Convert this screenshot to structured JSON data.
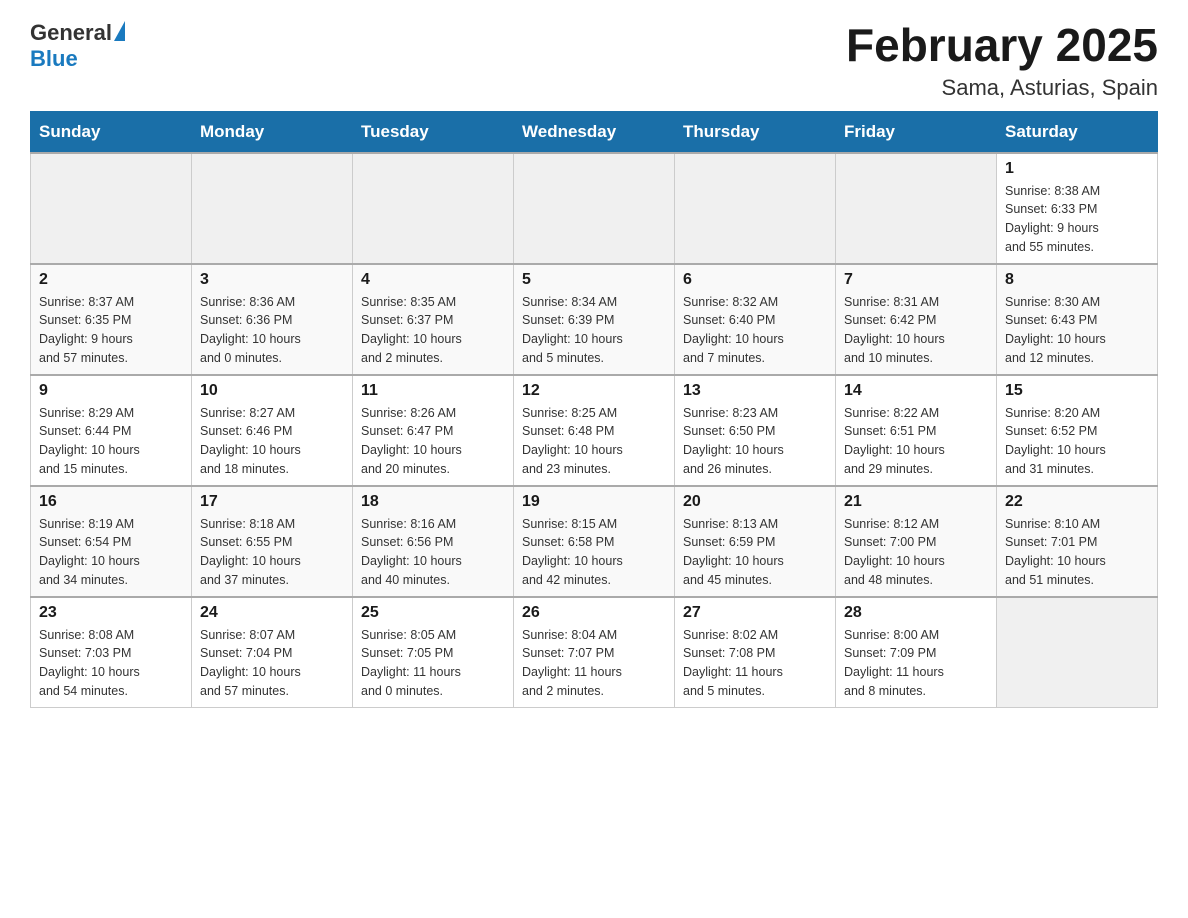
{
  "header": {
    "logo_general": "General",
    "logo_blue": "Blue",
    "title": "February 2025",
    "subtitle": "Sama, Asturias, Spain"
  },
  "days_of_week": [
    "Sunday",
    "Monday",
    "Tuesday",
    "Wednesday",
    "Thursday",
    "Friday",
    "Saturday"
  ],
  "weeks": [
    [
      {
        "day": "",
        "info": ""
      },
      {
        "day": "",
        "info": ""
      },
      {
        "day": "",
        "info": ""
      },
      {
        "day": "",
        "info": ""
      },
      {
        "day": "",
        "info": ""
      },
      {
        "day": "",
        "info": ""
      },
      {
        "day": "1",
        "info": "Sunrise: 8:38 AM\nSunset: 6:33 PM\nDaylight: 9 hours\nand 55 minutes."
      }
    ],
    [
      {
        "day": "2",
        "info": "Sunrise: 8:37 AM\nSunset: 6:35 PM\nDaylight: 9 hours\nand 57 minutes."
      },
      {
        "day": "3",
        "info": "Sunrise: 8:36 AM\nSunset: 6:36 PM\nDaylight: 10 hours\nand 0 minutes."
      },
      {
        "day": "4",
        "info": "Sunrise: 8:35 AM\nSunset: 6:37 PM\nDaylight: 10 hours\nand 2 minutes."
      },
      {
        "day": "5",
        "info": "Sunrise: 8:34 AM\nSunset: 6:39 PM\nDaylight: 10 hours\nand 5 minutes."
      },
      {
        "day": "6",
        "info": "Sunrise: 8:32 AM\nSunset: 6:40 PM\nDaylight: 10 hours\nand 7 minutes."
      },
      {
        "day": "7",
        "info": "Sunrise: 8:31 AM\nSunset: 6:42 PM\nDaylight: 10 hours\nand 10 minutes."
      },
      {
        "day": "8",
        "info": "Sunrise: 8:30 AM\nSunset: 6:43 PM\nDaylight: 10 hours\nand 12 minutes."
      }
    ],
    [
      {
        "day": "9",
        "info": "Sunrise: 8:29 AM\nSunset: 6:44 PM\nDaylight: 10 hours\nand 15 minutes."
      },
      {
        "day": "10",
        "info": "Sunrise: 8:27 AM\nSunset: 6:46 PM\nDaylight: 10 hours\nand 18 minutes."
      },
      {
        "day": "11",
        "info": "Sunrise: 8:26 AM\nSunset: 6:47 PM\nDaylight: 10 hours\nand 20 minutes."
      },
      {
        "day": "12",
        "info": "Sunrise: 8:25 AM\nSunset: 6:48 PM\nDaylight: 10 hours\nand 23 minutes."
      },
      {
        "day": "13",
        "info": "Sunrise: 8:23 AM\nSunset: 6:50 PM\nDaylight: 10 hours\nand 26 minutes."
      },
      {
        "day": "14",
        "info": "Sunrise: 8:22 AM\nSunset: 6:51 PM\nDaylight: 10 hours\nand 29 minutes."
      },
      {
        "day": "15",
        "info": "Sunrise: 8:20 AM\nSunset: 6:52 PM\nDaylight: 10 hours\nand 31 minutes."
      }
    ],
    [
      {
        "day": "16",
        "info": "Sunrise: 8:19 AM\nSunset: 6:54 PM\nDaylight: 10 hours\nand 34 minutes."
      },
      {
        "day": "17",
        "info": "Sunrise: 8:18 AM\nSunset: 6:55 PM\nDaylight: 10 hours\nand 37 minutes."
      },
      {
        "day": "18",
        "info": "Sunrise: 8:16 AM\nSunset: 6:56 PM\nDaylight: 10 hours\nand 40 minutes."
      },
      {
        "day": "19",
        "info": "Sunrise: 8:15 AM\nSunset: 6:58 PM\nDaylight: 10 hours\nand 42 minutes."
      },
      {
        "day": "20",
        "info": "Sunrise: 8:13 AM\nSunset: 6:59 PM\nDaylight: 10 hours\nand 45 minutes."
      },
      {
        "day": "21",
        "info": "Sunrise: 8:12 AM\nSunset: 7:00 PM\nDaylight: 10 hours\nand 48 minutes."
      },
      {
        "day": "22",
        "info": "Sunrise: 8:10 AM\nSunset: 7:01 PM\nDaylight: 10 hours\nand 51 minutes."
      }
    ],
    [
      {
        "day": "23",
        "info": "Sunrise: 8:08 AM\nSunset: 7:03 PM\nDaylight: 10 hours\nand 54 minutes."
      },
      {
        "day": "24",
        "info": "Sunrise: 8:07 AM\nSunset: 7:04 PM\nDaylight: 10 hours\nand 57 minutes."
      },
      {
        "day": "25",
        "info": "Sunrise: 8:05 AM\nSunset: 7:05 PM\nDaylight: 11 hours\nand 0 minutes."
      },
      {
        "day": "26",
        "info": "Sunrise: 8:04 AM\nSunset: 7:07 PM\nDaylight: 11 hours\nand 2 minutes."
      },
      {
        "day": "27",
        "info": "Sunrise: 8:02 AM\nSunset: 7:08 PM\nDaylight: 11 hours\nand 5 minutes."
      },
      {
        "day": "28",
        "info": "Sunrise: 8:00 AM\nSunset: 7:09 PM\nDaylight: 11 hours\nand 8 minutes."
      },
      {
        "day": "",
        "info": ""
      }
    ]
  ]
}
